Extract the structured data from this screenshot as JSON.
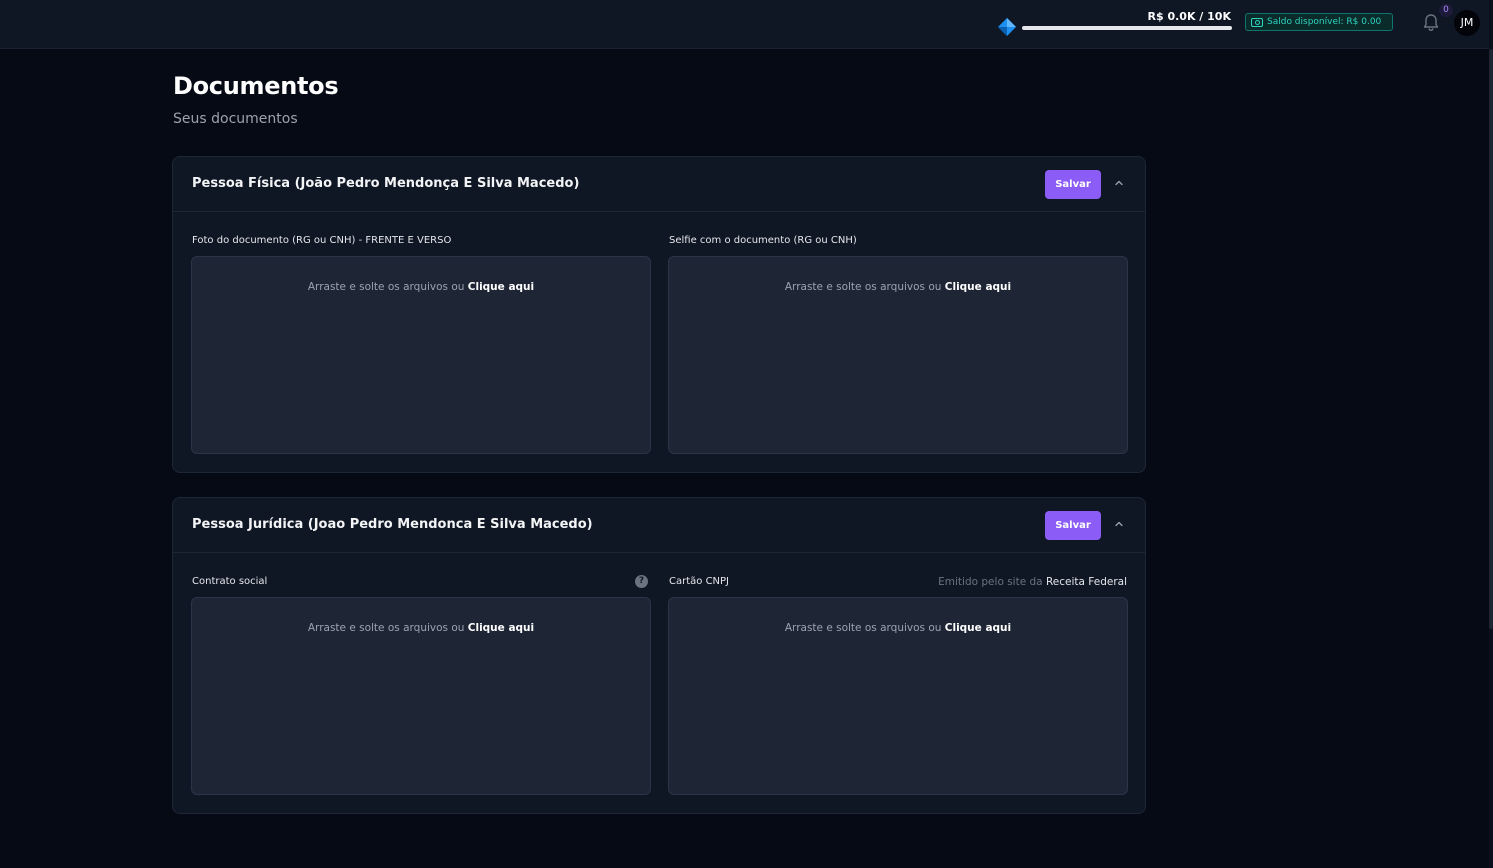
{
  "header": {
    "goal_text": "R$ 0.0K / 10K",
    "goal_progress": 0.0,
    "balance_label": "Saldo disponível: R$ 0.00",
    "notification_count": "0",
    "avatar_initials": "JM"
  },
  "page": {
    "title": "Documentos",
    "subtitle": "Seus documentos"
  },
  "sections": [
    {
      "title": "Pessoa Física (João Pedro Mendonça E Silva Macedo)",
      "save_label": "Salvar",
      "fields": [
        {
          "label": "Foto do documento (RG ou CNH) - FRENTE E VERSO",
          "drop_text": "Arraste e solte os arquivos ou",
          "drop_link": "Clique aqui"
        },
        {
          "label": "Selfie com o documento (RG ou CNH)",
          "drop_text": "Arraste e solte os arquivos ou",
          "drop_link": "Clique aqui"
        }
      ]
    },
    {
      "title": "Pessoa Jurídica (Joao Pedro Mendonca E Silva Macedo)",
      "save_label": "Salvar",
      "fields": [
        {
          "label": "Contrato social",
          "help": "?",
          "drop_text": "Arraste e solte os arquivos ou",
          "drop_link": "Clique aqui"
        },
        {
          "label": "Cartão CNPJ",
          "hint_text": "Emitido pelo site da",
          "hint_link": "Receita Federal",
          "drop_text": "Arraste e solte os arquivos ou",
          "drop_link": "Clique aqui"
        }
      ]
    }
  ],
  "colors": {
    "accent": "#8b5cf6",
    "balance": "#2dd4bf",
    "background": "#050a14",
    "panel": "#0f1624"
  }
}
